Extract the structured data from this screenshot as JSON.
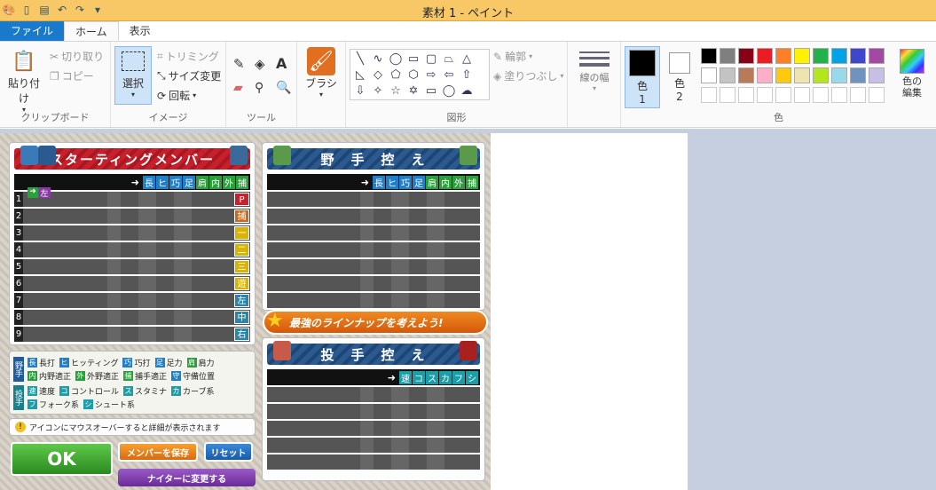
{
  "window": {
    "title": "素材 1 - ペイント"
  },
  "tabs": [
    "ファイル",
    "ホーム",
    "表示"
  ],
  "ribbon": {
    "clipboard": {
      "paste": "貼り付け",
      "cut": "切り取り",
      "copy": "コピー",
      "label": "クリップボード"
    },
    "image": {
      "select": "選択",
      "crop": "トリミング",
      "resize": "サイズ変更",
      "rotate": "回転",
      "label": "イメージ"
    },
    "tools": {
      "label": "ツール"
    },
    "brush": {
      "label": "ブラシ"
    },
    "shapes": {
      "outline": "輪郭",
      "fill": "塗りつぶし",
      "label": "図形"
    },
    "size": {
      "label": "線の幅"
    },
    "colors": {
      "color1": "色",
      "color1_num": "1",
      "color2": "色",
      "color2_num": "2",
      "edit": "色の編集",
      "label": "色",
      "palette_row1": [
        "#000000",
        "#7f7f7f",
        "#880015",
        "#ed1c24",
        "#ff7f27",
        "#fff200",
        "#22b14c",
        "#00a2e8",
        "#3f48cc",
        "#a349a4"
      ],
      "palette_row2": [
        "#ffffff",
        "#c3c3c3",
        "#b97a57",
        "#ffaec9",
        "#ffc90e",
        "#efe4b0",
        "#b5e61d",
        "#99d9ea",
        "#7092be",
        "#c8bfe7"
      ]
    }
  },
  "game": {
    "starting": {
      "title": "スターティングメンバー",
      "abilities": [
        "長",
        "ヒ",
        "巧",
        "足",
        "肩",
        "内",
        "外",
        "捕"
      ],
      "rows": [
        {
          "n": "1",
          "pos": "P",
          "color": "#c8202c"
        },
        {
          "n": "2",
          "pos": "捕",
          "color": "#c86a20"
        },
        {
          "n": "3",
          "pos": "一",
          "color": "#d8b400"
        },
        {
          "n": "4",
          "pos": "二",
          "color": "#d8b400"
        },
        {
          "n": "5",
          "pos": "三",
          "color": "#d8b400"
        },
        {
          "n": "6",
          "pos": "遊",
          "color": "#d8b400"
        },
        {
          "n": "7",
          "pos": "左",
          "color": "#2a86a8"
        },
        {
          "n": "8",
          "pos": "中",
          "color": "#2a86a8"
        },
        {
          "n": "9",
          "pos": "右",
          "color": "#2a86a8"
        }
      ],
      "batter_tag": "左"
    },
    "fielders": {
      "title": "野　手　控　え",
      "abilities": [
        "長",
        "ヒ",
        "巧",
        "足",
        "肩",
        "内",
        "外",
        "捕"
      ]
    },
    "banner": "最強のラインナップを考えよう!",
    "pitchers": {
      "title": "投　手　控　え",
      "abilities": [
        "速",
        "コ",
        "ス",
        "カ",
        "フ",
        "シ"
      ]
    },
    "legend": {
      "fielder_tag": "野手",
      "fielder_items": [
        [
          "長",
          "長打"
        ],
        [
          "ヒ",
          "ヒッティング"
        ],
        [
          "巧",
          "巧打"
        ],
        [
          "足",
          "足力"
        ],
        [
          "肩",
          "肩力"
        ],
        [
          "内",
          "内野適正"
        ],
        [
          "外",
          "外野適正"
        ],
        [
          "捕",
          "捕手適正"
        ],
        [
          "守",
          "守備位置"
        ]
      ],
      "pitcher_tag": "投手",
      "pitcher_items": [
        [
          "速",
          "速度"
        ],
        [
          "コ",
          "コントロール"
        ],
        [
          "ス",
          "スタミナ"
        ],
        [
          "カ",
          "カーブ系"
        ],
        [
          "フ",
          "フォーク系"
        ],
        [
          "シ",
          "シュート系"
        ]
      ]
    },
    "hint": "アイコンにマウスオーバーすると詳細が表示されます",
    "ok": "OK",
    "save": "メンバーを保存",
    "reset": "リセット",
    "night": "ナイターに変更する"
  }
}
